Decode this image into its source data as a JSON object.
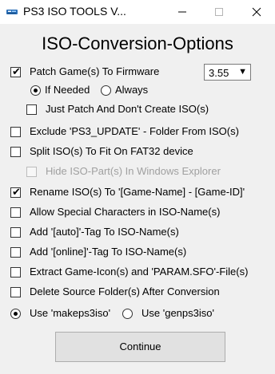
{
  "window": {
    "title": "PS3 ISO TOOLS V...",
    "minimize_icon": "minimize-icon",
    "maximize_icon": "maximize-icon",
    "close_icon": "close-icon"
  },
  "heading": "ISO-Conversion-Options",
  "firmware": {
    "label": "Patch Game(s) To Firmware",
    "checked": true,
    "selected": "3.55",
    "when_label": "If Needed",
    "always_label": "Always",
    "patch_only_label": "Just Patch And Don't Create ISO(s)"
  },
  "options": [
    {
      "label": "Exclude 'PS3_UPDATE' - Folder From ISO(s)",
      "checked": false
    },
    {
      "label": "Split ISO(s) To Fit On FAT32 device",
      "checked": false
    },
    {
      "label": "Hide ISO-Part(s) In Windows Explorer",
      "checked": false,
      "disabled": true
    },
    {
      "label": "Rename ISO(s) To '[Game-Name] - [Game-ID]'",
      "checked": true
    },
    {
      "label": "Allow Special Characters in ISO-Name(s)",
      "checked": false
    },
    {
      "label": "Add '[auto]'-Tag To ISO-Name(s)",
      "checked": false
    },
    {
      "label": "Add '[online]'-Tag To ISO-Name(s)",
      "checked": false
    },
    {
      "label": "Extract Game-Icon(s) and 'PARAM.SFO'-File(s)",
      "checked": false
    },
    {
      "label": "Delete Source Folder(s) After Conversion",
      "checked": false
    }
  ],
  "tool": {
    "makeps3iso_label": "Use 'makeps3iso'",
    "genps3iso_label": "Use 'genps3iso'",
    "selected": "makeps3iso"
  },
  "continue_label": "Continue"
}
